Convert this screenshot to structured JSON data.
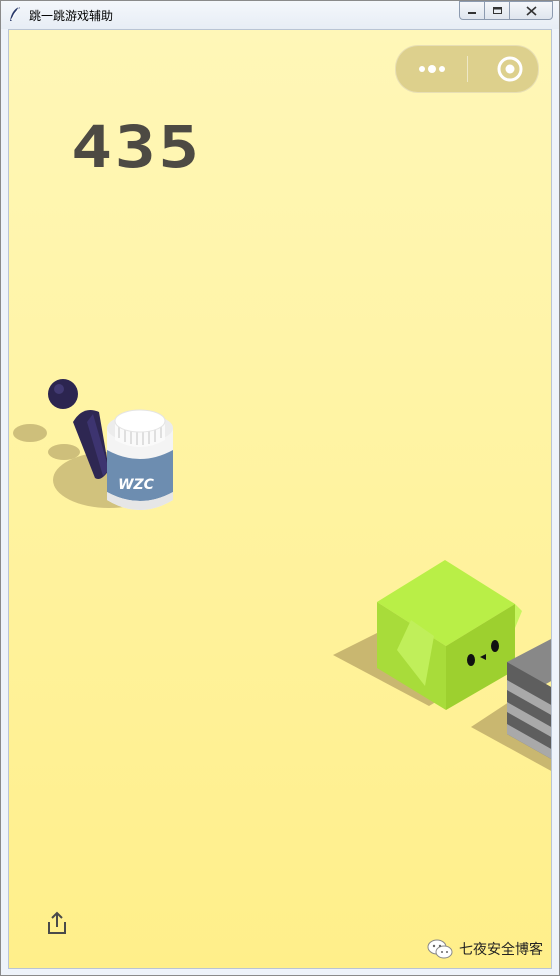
{
  "window": {
    "title": "跳一跳游戏辅助",
    "controls": [
      "minimize",
      "maximize",
      "close"
    ]
  },
  "game": {
    "score": "435",
    "bottle_label": "WZC"
  },
  "capsule": {
    "more_icon": "more-dots-icon",
    "close_icon": "target-circle-icon"
  },
  "footer": {
    "share_icon": "share-icon",
    "watermark": "七夜安全博客"
  },
  "colors": {
    "background_top": "#fff7b8",
    "background_bottom": "#ffef8a",
    "score": "#4d4a43",
    "green_cube": "#b5ec45",
    "bottle_label": "#6d8db0",
    "piece": "#3a3260"
  }
}
